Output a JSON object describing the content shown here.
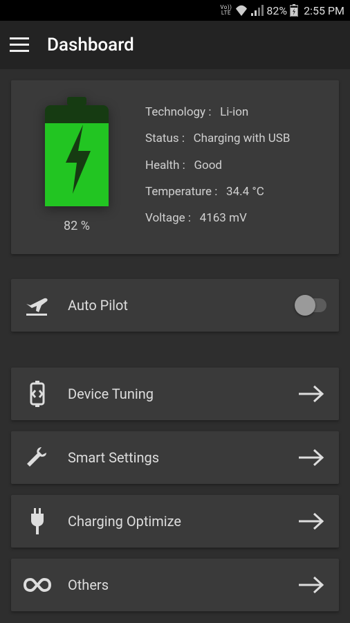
{
  "statusbar": {
    "volte": "Vo))\nLTE",
    "battery_percent_text": "82%",
    "time": "2:55 PM"
  },
  "appbar": {
    "title": "Dashboard"
  },
  "battery": {
    "percent_label": "82 %",
    "info": {
      "technology_label": "Technology :",
      "technology_value": "Li-ion",
      "status_label": "Status :",
      "status_value": "Charging with USB",
      "health_label": "Health :",
      "health_value": "Good",
      "temperature_label": "Temperature :",
      "temperature_value": "34.4 °C",
      "voltage_label": "Voltage :",
      "voltage_value": "4163 mV"
    }
  },
  "autopilot": {
    "label": "Auto Pilot",
    "enabled": false
  },
  "menu": {
    "device_tuning": "Device Tuning",
    "smart_settings": "Smart Settings",
    "charging_optimize": "Charging Optimize",
    "others": "Others"
  }
}
